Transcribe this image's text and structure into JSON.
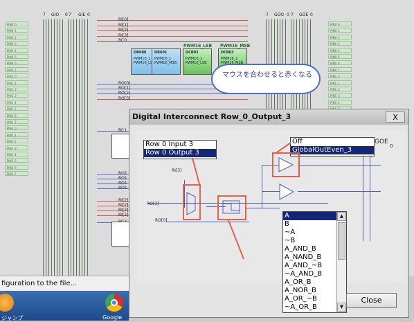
{
  "background": {
    "bus_labels_left": [
      "7",
      "GIO",
      "0",
      "7",
      "GIE",
      "0"
    ],
    "bus_labels_right": [
      "7",
      "GOO",
      "0",
      "7",
      "GOE",
      "0"
    ],
    "pin_labels": [
      "PIN0_0",
      "PIN0_1",
      "PIN0_2",
      "PIN0_3",
      "PIN0_4",
      "PIN0_5",
      "PIN0_6",
      "PIN0_7",
      "PIN1_0",
      "PIN1_1",
      "PIN1_2",
      "PIN1_3",
      "PIN1_4",
      "PIN1_5",
      "PIN1_6",
      "PIN1_7",
      "PIN2_0",
      "PIN2_1",
      "PIN2_2",
      "PIN2_3",
      "PIN2_4",
      "PIN2_5",
      "PIN2_6",
      "PIN2_7"
    ],
    "nets_top": [
      "RI[0]",
      "RI[1]",
      "RI[2]",
      "RI[3]",
      "BC0"
    ],
    "nets_mid": [
      "RO[0]",
      "RO[1]",
      "RO[2]",
      "RO[3]"
    ],
    "nets_left_lower": [
      "BC1",
      "RO1",
      "RO1",
      "RO1",
      "RO1",
      "RI[2]",
      "RI[2]",
      "RI[2]",
      "RI[2]",
      "BC2"
    ],
    "blocks": [
      {
        "name": "DB600",
        "l1": "PWM16_1",
        "l2": "PWM16_LSB"
      },
      {
        "name": "DB601",
        "l1": "PWM16_1",
        "l2": "PWM16_MSB"
      },
      {
        "name": "DCB02",
        "l1": "PWM16_2",
        "l2": "PWM16_LSB"
      },
      {
        "name": "DCB03",
        "l1": "PWM16_2",
        "l2": "PWM16_MSB"
      }
    ],
    "green_labels": [
      "PWM16_LSB",
      "PWM16_MSB"
    ]
  },
  "tooltip": {
    "text": "マウスを合わせると赤くなる"
  },
  "dialog": {
    "title": "Digital Interconnect Row_0_Output_3",
    "close_x": "X",
    "input_dropdown": {
      "options": [
        "Row 0 Input 3",
        "Row 0 Output 3"
      ],
      "selected": "Row 0 Output 3"
    },
    "output_dropdown": {
      "options": [
        "Off",
        "GlobalOutEven_3"
      ],
      "selected": "GlobalOutEven_3"
    },
    "labels": {
      "ri": "RI[3]",
      "ro3": "RO[3]",
      "ro0": "RO[0]",
      "goe": "GOE",
      "goe_idx": "0"
    },
    "logic_options": [
      "A",
      "B",
      "~A",
      "~B",
      "A_AND_B",
      "A_NAND_B",
      "A_AND_~B",
      "~A_AND_B",
      "A_OR_B",
      "A_NOR_B",
      "A_OR_~B",
      "~A_OR_B"
    ],
    "logic_selected": "A",
    "close_button": "Close"
  },
  "status_bar": {
    "text": "figuration to the file..."
  },
  "taskbar": {
    "items": [
      "ジャンプ",
      "Google"
    ]
  }
}
